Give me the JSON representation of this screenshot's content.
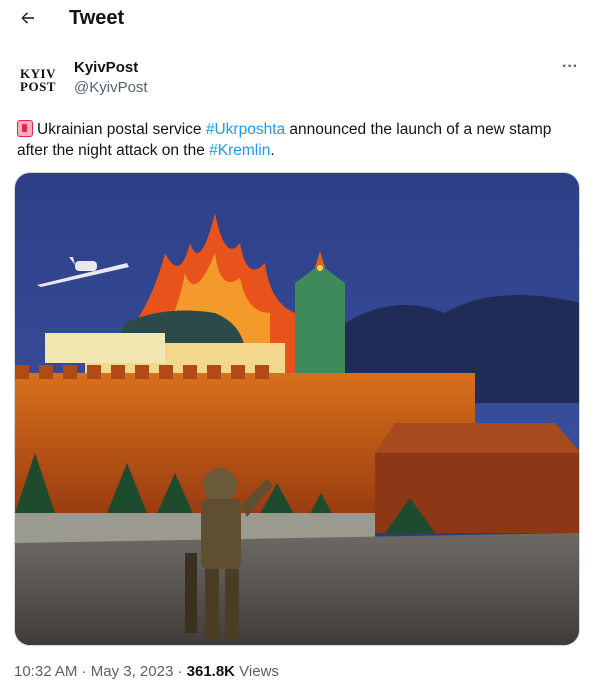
{
  "header": {
    "title": "Tweet",
    "back_icon": "arrow-left-icon"
  },
  "author": {
    "avatar_line1": "KYIV",
    "avatar_line2": "POST",
    "name": "KyivPost",
    "handle": "@KyivPost",
    "more_icon": "more-horizontal-icon",
    "more_label": "···"
  },
  "tweet": {
    "emoji": "postbox-emoji",
    "text_part1": "Ukrainian postal service ",
    "hashtag1": "#Ukrposhta",
    "text_part2": " announced the launch of a new stamp after the night attack on the ",
    "hashtag2": "#Kremlin",
    "text_part3": ".",
    "link_color": "#1d9bf0"
  },
  "media": {
    "kind": "illustration",
    "depicts": "stamp-artwork"
  },
  "meta": {
    "time": "10:32 AM",
    "sep1": " · ",
    "date": "May 3, 2023",
    "sep2": " · ",
    "views": "361.8K",
    "views_label": " Views"
  }
}
